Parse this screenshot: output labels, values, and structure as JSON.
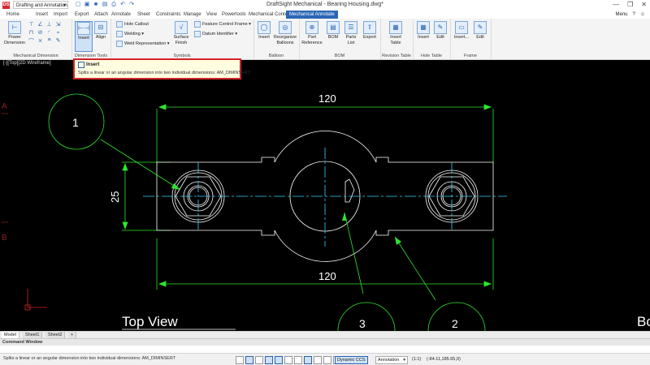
{
  "titlebar": {
    "app_icon": "DS",
    "workspace": "Drafting and Annotation",
    "window_title": "DraftSight Mechanical - Bearing Housing.dwg*",
    "qat_icons": [
      "new-icon",
      "open-icon",
      "save-icon",
      "save-as-icon",
      "print-icon",
      "undo-icon",
      "redo-icon"
    ],
    "controls": {
      "minimize": "—",
      "restore": "❐",
      "close": "✕"
    }
  },
  "tabs": {
    "items": [
      "Home",
      "Insert",
      "Import",
      "Export",
      "Attach",
      "Annotate",
      "Sheet",
      "Constraints",
      "Manage",
      "View",
      "Powertools",
      "Mechanical Content",
      "Mechanical Annotate"
    ],
    "active_index": 12,
    "menu_label": "Menu",
    "menu_icons": [
      "help-icon",
      "user-icon"
    ]
  },
  "ribbon": {
    "groups": [
      {
        "label": "Mechanical Dimension",
        "power_dimension": "Power Dimension"
      },
      {
        "label": "Dimension Tools",
        "insert": "Insert",
        "align": "Align"
      },
      {
        "label": "Symbols",
        "hole_callout": "Hole Callout",
        "welding": "Welding",
        "weld_rep": "Weld Representation",
        "surface_finish": "Surface Finish",
        "feature_control": "Feature Control Frame",
        "datum_identifier": "Datum Identifier"
      },
      {
        "label": "Balloon",
        "insert": "Insert",
        "reorganize": "Reorganize Balloons"
      },
      {
        "label": "BOM",
        "part_reference": "Part Reference",
        "bom": "BOM",
        "parts_list": "Parts List",
        "export": "Export"
      },
      {
        "label": "Revision Table",
        "insert_table": "Insert Table"
      },
      {
        "label": "Hole Table",
        "insert": "Insert",
        "edit": "Edit"
      },
      {
        "label": "Frame",
        "insert": "Insert...",
        "edit": "Edit"
      }
    ]
  },
  "tooltip": {
    "title": "Insert",
    "description": "Splits a linear or an angular dimension into two individual dimensions: AM_DIMINSERT"
  },
  "canvas": {
    "view_label": "[-][Top][2D Wireframe]",
    "dim_top": "120",
    "dim_bottom": "120",
    "dim_left": "25",
    "balloons": [
      "1",
      "3",
      "2"
    ],
    "title_text": "Top View",
    "title_text_right": "Bo",
    "border_letters": [
      "A",
      "B"
    ]
  },
  "sheet_tabs": {
    "items": [
      "Model",
      "Sheet1",
      "Sheet2"
    ],
    "add": "+"
  },
  "command": {
    "header": "Command Window",
    "prompt": ""
  },
  "status": {
    "message": "Splits a linear or an angular dimension into two individual dimensions: AM_DIMINSERT",
    "dynamic_ccs": "Dynamic CCS",
    "annotation": "Annotation",
    "scale": "(1:1)",
    "coords": "(-84.11,185.65,0)"
  },
  "colors": {
    "geometry": "#ffffff",
    "dimension": "#2ee62e",
    "centerline": "#3ad1ff",
    "accent": "#2b66b4",
    "tooltip_border": "#d4242a"
  }
}
